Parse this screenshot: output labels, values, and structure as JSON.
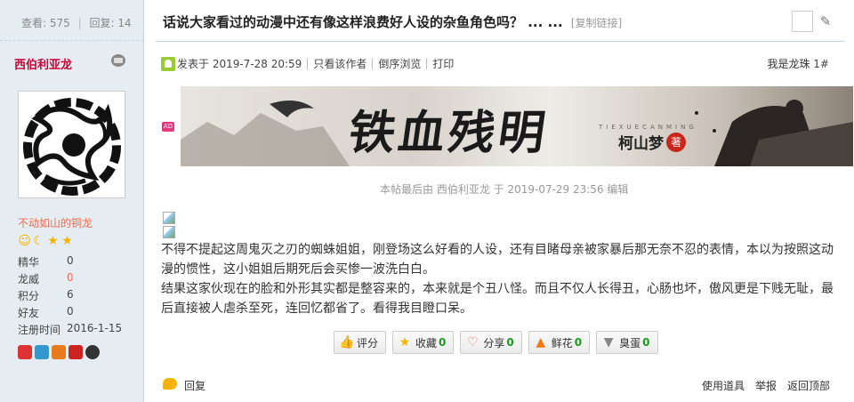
{
  "sidebar": {
    "stats": {
      "views_label": "查看:",
      "views": "575",
      "replies_label": "回复:",
      "replies": "14"
    },
    "username": "西伯利亚龙",
    "rank": "不动如山的铜龙",
    "profile": [
      {
        "key": "精华",
        "value": "0"
      },
      {
        "key": "龙威",
        "value": "0"
      },
      {
        "key": "积分",
        "value": "6"
      },
      {
        "key": "好友",
        "value": "0"
      },
      {
        "key": "注册时间",
        "value": "2016-1-15"
      }
    ]
  },
  "thread": {
    "title": "话说大家看过的动漫中还有像这样浪费好人设的杂鱼角色吗？ ... ...",
    "copy_link": "[复制链接]"
  },
  "postbar": {
    "posted_at": "发表于 2019-7-28 20:59",
    "only_author": "只看该作者",
    "reverse": "倒序浏览",
    "print": "打印",
    "floor_label": "我是龙珠",
    "floor_number": "1#"
  },
  "ad": {
    "tag": "AD",
    "banner_title": "铁血残明",
    "banner_pinyin": "TIEXUECANMING",
    "banner_author": "柯山梦",
    "banner_seal": "著"
  },
  "edit_note": "本帖最后由 西伯利亚龙 于 2019-07-29 23:56 编辑",
  "body": {
    "para1": "不得不提起这周鬼灭之刃的蜘蛛姐姐，刚登场这么好看的人设，还有目睹母亲被家暴后那无奈不忍的表情，本以为按照这动漫的惯性，这小姐姐后期死后会买惨一波洗白白。",
    "para2": "结果这家伙现在的脸和外形其实都是整容来的，本来就是个丑八怪。而且不仅人长得丑，心肠也坏，傲风更是下贱无耻，最后直接被人虐杀至死，连回忆都省了。看得我目瞪口呆。"
  },
  "actions": {
    "rate": "评分",
    "favorite": "收藏",
    "favorite_count": "0",
    "share": "分享",
    "share_count": "0",
    "flower": "鲜花",
    "flower_count": "0",
    "egg": "臭蛋",
    "egg_count": "0"
  },
  "footer": {
    "reply": "回复",
    "use_tool": "使用道具",
    "report": "举报",
    "back_top": "返回顶部"
  },
  "colors": {
    "sidebar_bg": "#e5edf2",
    "username": "#cc0033",
    "rank": "#f26c4f",
    "count_green": "#1a9a1a"
  }
}
